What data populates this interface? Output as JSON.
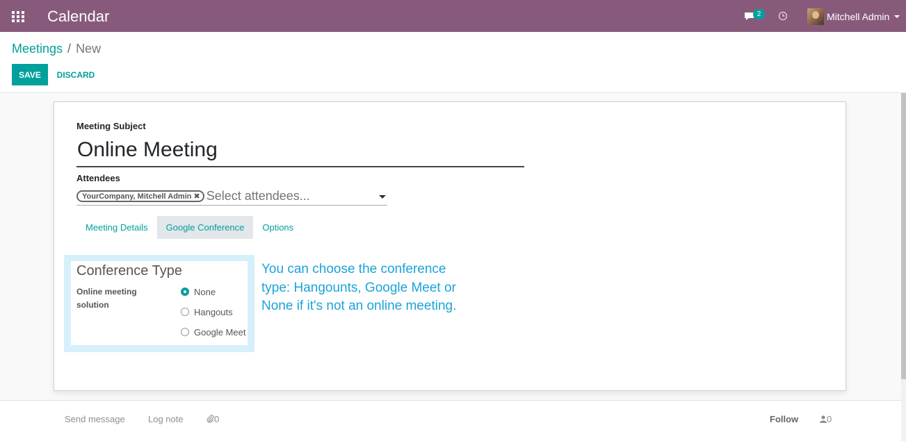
{
  "navbar": {
    "app_title": "Calendar",
    "chat_count": "2",
    "user_name": "Mitchell Admin"
  },
  "breadcrumb": {
    "parent": "Meetings",
    "separator": "/",
    "current": "New"
  },
  "buttons": {
    "save": "SAVE",
    "discard": "DISCARD"
  },
  "form": {
    "subject_label": "Meeting Subject",
    "subject_value": "Online Meeting",
    "attendees_label": "Attendees",
    "attendee_tag": "YourCompany, Mitchell Admin",
    "attendee_placeholder": "Select attendees...",
    "tabs": [
      {
        "label": "Meeting Details",
        "active": false
      },
      {
        "label": "Google Conference",
        "active": true
      },
      {
        "label": "Options",
        "active": false
      }
    ],
    "conference": {
      "title": "Conference Type",
      "field_label": "Online meeting solution",
      "options": [
        {
          "label": "None",
          "checked": true
        },
        {
          "label": "Hangouts",
          "checked": false
        },
        {
          "label": "Google Meet",
          "checked": false
        }
      ]
    }
  },
  "annotation": "You can choose the conference type: Hangounts, Google Meet or None if it's not an online meeting.",
  "chatter": {
    "send_message": "Send message",
    "log_note": "Log note",
    "attachments": "0",
    "follow": "Follow",
    "followers": "0"
  },
  "colors": {
    "navbar": "#875a7b",
    "accent": "#00a09d",
    "annotation": "#1ba3d9",
    "highlight": "#d6f0fb"
  }
}
